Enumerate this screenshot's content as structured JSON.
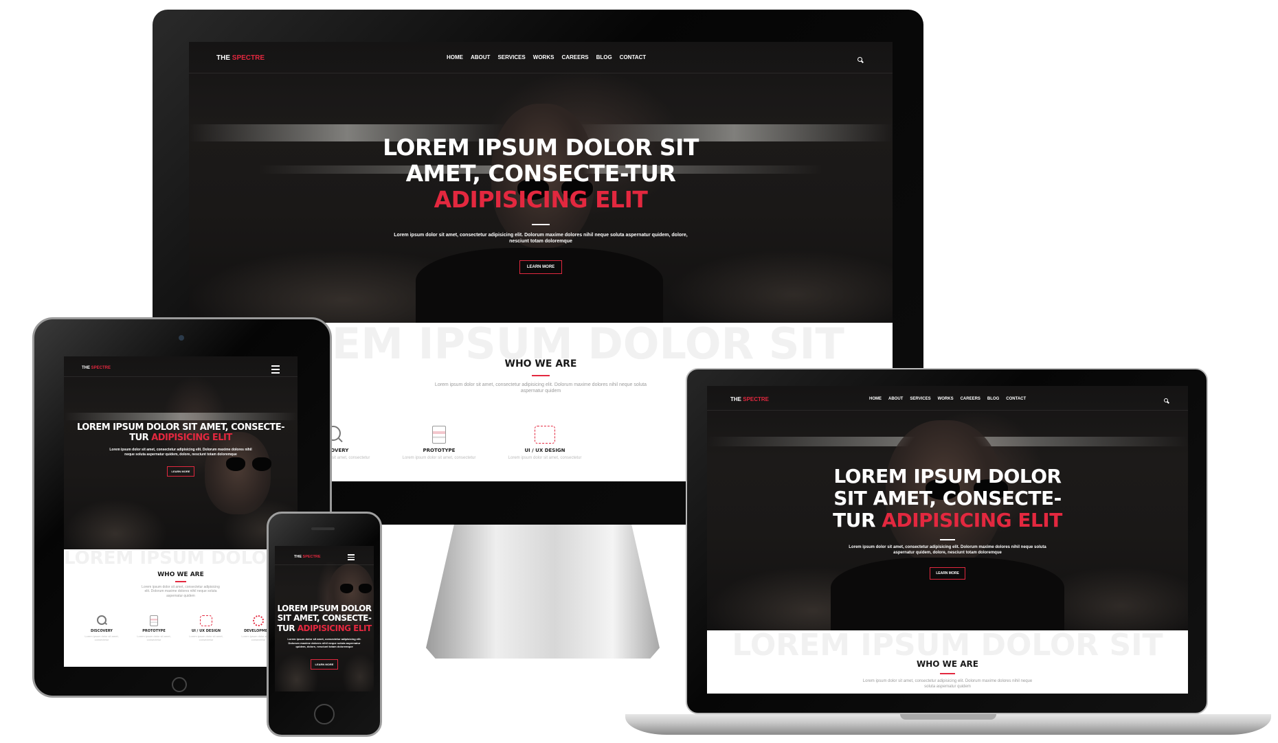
{
  "brand": {
    "part1": "THE ",
    "part2": "SPECTRE",
    "accent_color": "#e3283f"
  },
  "nav": [
    "HOME",
    "ABOUT",
    "SERVICES",
    "WORKS",
    "CAREERS",
    "BLOG",
    "CONTACT"
  ],
  "hero": {
    "title_white_a": "LOREM IPSUM DOLOR SIT",
    "title_white_b": "AMET, CONSECTE-TUR",
    "title_accent": "ADIPISICING ELIT",
    "laptop_line1": "LOREM IPSUM DOLOR",
    "laptop_line2": "SIT AMET, CONSECTE-",
    "laptop_line3": "TUR ",
    "tablet_line1": "LOREM IPSUM DOLOR SIT AMET, CONSECTE-",
    "tablet_line2": "TUR ",
    "phone_line1": "LOREM IPSUM DOLOR",
    "phone_line2": "SIT AMET, CONSECTE-",
    "phone_line3": "TUR ",
    "description": "Lorem ipsum dolor sit amet, consectetur adipisicing elit. Dolorum maxime dolores nihil neque soluta aspernatur quidem, dolore, nesciunt totam doloremque",
    "button": "LEARN MORE"
  },
  "who": {
    "bg_word": "LOREM IPSUM DOLOR SIT",
    "title": "WHO WE ARE",
    "description": "Lorem ipsum dolor sit amet, consectetur adipisicing elit. Dolorum maxime dolores nihil neque soluta aspernatur quidem"
  },
  "features": [
    {
      "label": "DISCOVERY",
      "icon": "magnifier-icon",
      "text": "Lorem ipsum dolor sit amet, consectetur"
    },
    {
      "label": "PROTOTYPE",
      "icon": "document-icon",
      "text": "Lorem ipsum dolor sit amet, consectetur"
    },
    {
      "label": "UI / UX DESIGN",
      "icon": "tools-icon",
      "text": "Lorem ipsum dolor sit amet, consectetur"
    },
    {
      "label": "DEVELOPMENT",
      "icon": "gear-icon",
      "text": "Lorem ipsum dolor sit amet, consectetur"
    }
  ]
}
